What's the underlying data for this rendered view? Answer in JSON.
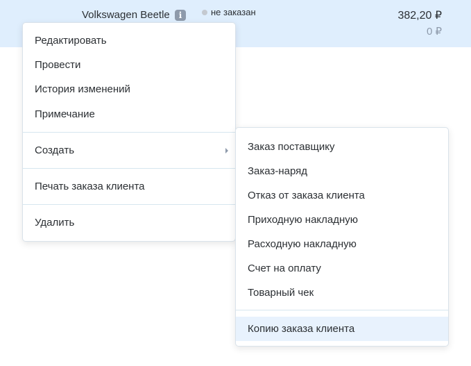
{
  "row": {
    "product_name": "Volkswagen Beetle",
    "info_icon": "i",
    "status": "не заказан",
    "status_color": "#c4c9d0",
    "amount": "382,20 ₽",
    "amount_secondary": "0 ₽",
    "highlight_color": "#dfeefd"
  },
  "context_menu": {
    "items": [
      {
        "label": "Редактировать"
      },
      {
        "label": "Провести"
      },
      {
        "label": "История изменений"
      },
      {
        "label": "Примечание"
      },
      {
        "label": "Создать",
        "has_submenu": true
      },
      {
        "label": "Печать заказа клиента"
      },
      {
        "label": "Удалить"
      }
    ]
  },
  "submenu": {
    "items": [
      {
        "label": "Заказ поставщику"
      },
      {
        "label": "Заказ-наряд"
      },
      {
        "label": "Отказ от заказа клиента"
      },
      {
        "label": "Приходную накладную"
      },
      {
        "label": "Расходную накладную"
      },
      {
        "label": "Счет на оплату"
      },
      {
        "label": "Товарный чек"
      },
      {
        "label": "Копию заказа клиента",
        "hovered": true
      }
    ]
  }
}
